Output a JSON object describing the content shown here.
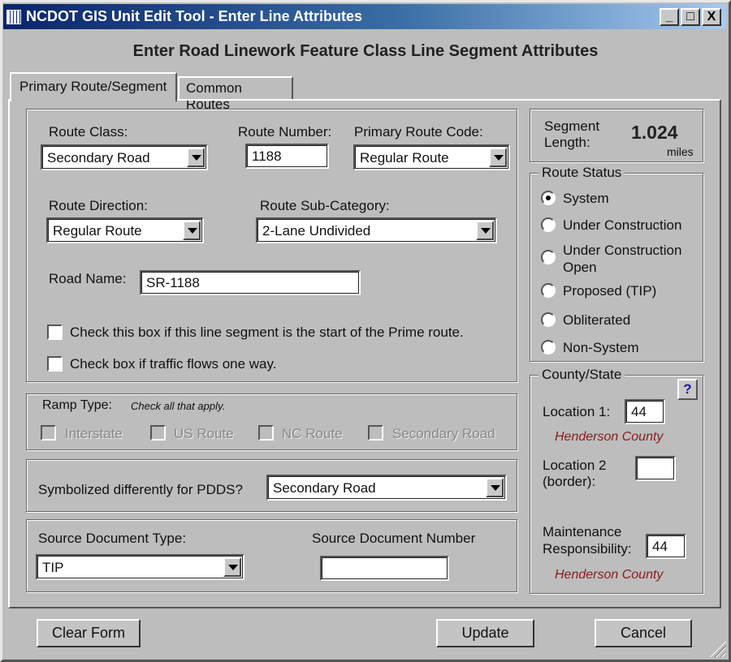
{
  "window": {
    "title": "NCDOT GIS Unit Edit Tool - Enter Line Attributes",
    "minimize": "_",
    "maximize": "□",
    "close": "X"
  },
  "heading": "Enter Road Linework Feature Class Line Segment Attributes",
  "tabs": [
    {
      "label": "Primary Route/Segment",
      "active": true
    },
    {
      "label": "Common Routes",
      "active": false
    }
  ],
  "route": {
    "class_label": "Route Class:",
    "class_value": "Secondary Road",
    "number_label": "Route Number:",
    "number_value": "1188",
    "code_label": "Primary Route Code:",
    "code_value": "Regular Route",
    "direction_label": "Route Direction:",
    "direction_value": "Regular Route",
    "subcat_label": "Route Sub-Category:",
    "subcat_value": "2-Lane Undivided",
    "road_name_label": "Road Name:",
    "road_name_value": "SR-1188",
    "prime_start_label": "Check this box if this line segment is the start of the Prime route.",
    "prime_start_checked": false,
    "one_way_label": "Check box if traffic flows one way.",
    "one_way_checked": false
  },
  "ramp": {
    "label": "Ramp Type:",
    "hint": "Check all that apply.",
    "options": [
      {
        "label": "Interstate",
        "checked": false
      },
      {
        "label": "US Route",
        "checked": false
      },
      {
        "label": "NC Route",
        "checked": false
      },
      {
        "label": "Secondary Road",
        "checked": false
      }
    ]
  },
  "pdds": {
    "label": "Symbolized differently for PDDS?",
    "value": "Secondary Road"
  },
  "source": {
    "type_label": "Source Document Type:",
    "type_value": "TIP",
    "number_label": "Source Document Number",
    "number_value": ""
  },
  "segment": {
    "label_1": "Segment",
    "label_2": "Length:",
    "value": "1.024",
    "unit": "miles"
  },
  "route_status": {
    "title": "Route Status",
    "options": [
      {
        "label": "System",
        "selected": true
      },
      {
        "label": "Under Construction",
        "selected": false
      },
      {
        "label": "Under Construction Open",
        "selected": false
      },
      {
        "label": "Proposed (TIP)",
        "selected": false
      },
      {
        "label": "Obliterated",
        "selected": false
      },
      {
        "label": "Non-System",
        "selected": false
      }
    ]
  },
  "county": {
    "title": "County/State",
    "help": "?",
    "loc1_label": "Location 1:",
    "loc1_value": "44",
    "loc1_name": "Henderson County",
    "loc2_label_1": "Location 2",
    "loc2_label_2": "(border):",
    "loc2_value": "",
    "maint_label_1": "Maintenance",
    "maint_label_2": "Responsibility:",
    "maint_value": "44",
    "maint_name": "Henderson County"
  },
  "buttons": {
    "clear": "Clear Form",
    "update": "Update",
    "cancel": "Cancel"
  }
}
